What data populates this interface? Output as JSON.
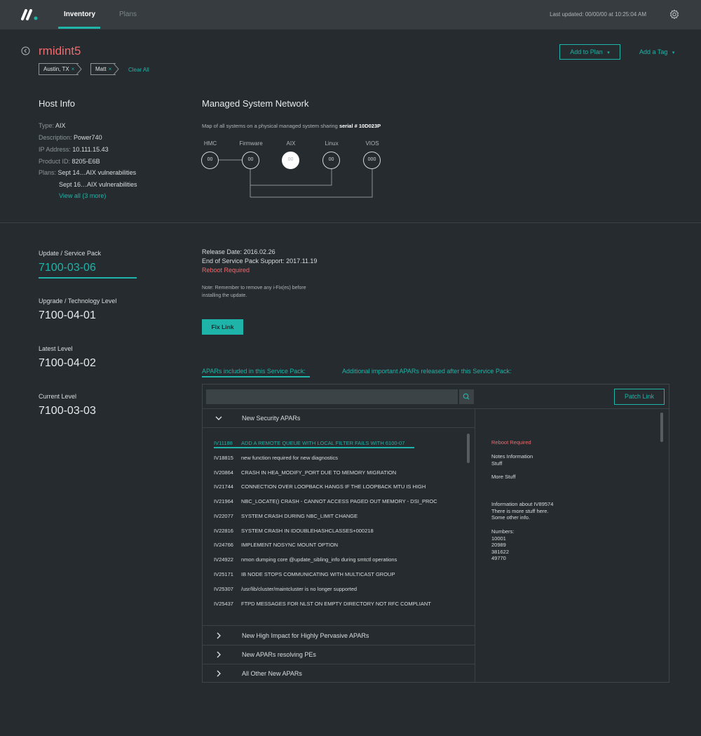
{
  "nav": {
    "tabs": [
      {
        "label": "Inventory",
        "active": true
      },
      {
        "label": "Plans",
        "active": false
      }
    ],
    "last_updated": "Last updated: 00/00/00 at 10:25:04 AM"
  },
  "header": {
    "title": "rmidint5",
    "tags": [
      "Austin, TX",
      "Matt"
    ],
    "tag_remove_glyph": "×",
    "clear_all": "Clear All",
    "add_to_plan": "Add to Plan",
    "add_a_tag": "Add a Tag",
    "dropdown_glyph": "▾"
  },
  "host_info": {
    "heading": "Host Info",
    "type_label": "Type:",
    "type": "AIX",
    "description_label": "Description:",
    "description": "Power740",
    "ip_label": "IP Address:",
    "ip": "10.111.15.43",
    "product_label": "Product ID:",
    "product": "8205-E6B",
    "plans_label": "Plans:",
    "plans": [
      "Sept 14…AIX vulnerabilities",
      "Sept 16…AIX vulnerabilities"
    ],
    "view_all": "View all (3 more)"
  },
  "network": {
    "heading": "Managed System Network",
    "caption": "Map of all systems on a physical managed system sharing",
    "serial": "serial # 10D023P",
    "nodes": [
      {
        "label": "HMC",
        "value": "00",
        "active": false
      },
      {
        "label": "Firmware",
        "value": "00",
        "active": false
      },
      {
        "label": "AIX",
        "value": "00",
        "active": true
      },
      {
        "label": "Linux",
        "value": "00",
        "active": false
      },
      {
        "label": "VIOS",
        "value": "000",
        "active": false
      }
    ]
  },
  "levels": {
    "update_label": "Update / Service Pack",
    "update_value": "7100-03-06",
    "upgrade_label": "Upgrade / Technology Level",
    "upgrade_value": "7100-04-01",
    "latest_label": "Latest Level",
    "latest_value": "7100-04-02",
    "current_label": "Current Level",
    "current_value": "7100-03-03"
  },
  "service_pack": {
    "release_date": "Release Date: 2016.02.26",
    "end_support": "End of Service Pack Support: 2017.11.19",
    "reboot": "Reboot Required",
    "note_line1": "Note: Remember to remove any i-Fix(es) before",
    "note_line2": "installing the update.",
    "fix_link": "Fix Link"
  },
  "apars": {
    "tabs": [
      {
        "label": "APARs included in this Service Pack:",
        "active": true
      },
      {
        "label": "Additional important APARs released after this Service Pack:",
        "active": false
      }
    ],
    "search_placeholder": "",
    "patch_link": "Patch Link",
    "groups": [
      {
        "label": "New Security APARs",
        "expanded": true
      },
      {
        "label": "New High Impact for Highly Pervasive APARs",
        "expanded": false
      },
      {
        "label": "New APARs resolving PEs",
        "expanded": false
      },
      {
        "label": "All Other New APARs",
        "expanded": false
      }
    ],
    "items": [
      {
        "id": "IV11188",
        "desc": "ADD A REMOTE QUEUE WITH LOCAL FILTER FAILS WITH 6100-07",
        "selected": true
      },
      {
        "id": "IV18815",
        "desc": "new function required for new diagnostics",
        "selected": false
      },
      {
        "id": "IV20864",
        "desc": "CRASH IN HEA_MODIFY_PORT DUE TO MEMORY MIGRATION",
        "selected": false
      },
      {
        "id": "IV21744",
        "desc": "CONNECTION OVER LOOPBACK HANGS IF THE LOOPBACK MTU IS HIGH",
        "selected": false
      },
      {
        "id": "IV21964",
        "desc": "NBC_LOCATE() CRASH - CANNOT ACCESS PAGED OUT MEMORY - DSI_PROC",
        "selected": false
      },
      {
        "id": "IV22077",
        "desc": "SYSTEM CRASH DURING NBC_LIMIT CHANGE",
        "selected": false
      },
      {
        "id": "IV22816",
        "desc": "SYSTEM CRASH IN IDOUBLEHASHCLASSES+000218",
        "selected": false
      },
      {
        "id": "IV24766",
        "desc": "IMPLEMENT NOSYNC MOUNT OPTION",
        "selected": false
      },
      {
        "id": "IV24922",
        "desc": "nmon dumping core @update_sibling_info during smtctl operations",
        "selected": false
      },
      {
        "id": "IV25171",
        "desc": "IB NODE STOPS COMMUNICATING WITH MULTICAST GROUP",
        "selected": false
      },
      {
        "id": "IV25307",
        "desc": "/usr/lib/cluster/maintcluster is no longer supported",
        "selected": false
      },
      {
        "id": "IV25437",
        "desc": "FTPD MESSAGES FOR NLST ON EMPTY DIRECTORY NOT RFC COMPLIANT",
        "selected": false
      }
    ],
    "detail": {
      "reboot": "Reboot Required",
      "notes": [
        "Notes Information",
        "Stuff"
      ],
      "more": "More Stuff",
      "info": [
        "Information about IV89574",
        "There is more stuff here.",
        "Some other info."
      ],
      "numbers_label": "Numbers:",
      "numbers": [
        "10001",
        "20989",
        "381622",
        "49770"
      ]
    }
  },
  "colors": {
    "accent": "#1fb4a9",
    "warning": "#f06a6e",
    "background": "#252b2e",
    "topbar": "#363c40"
  },
  "icons": [
    "logo-icon",
    "gear-icon",
    "back-icon",
    "search-icon",
    "chevron-down-icon",
    "chevron-right-icon"
  ]
}
